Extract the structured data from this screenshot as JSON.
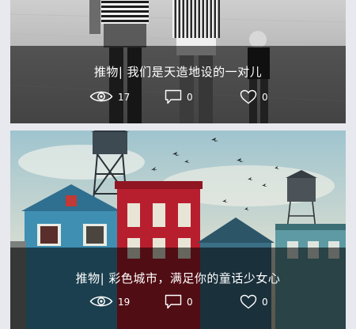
{
  "posts": [
    {
      "title": "推物| 我们是天造地设的一对儿",
      "views": "17",
      "comments": "0",
      "likes": "0",
      "image_icon": "family-beach-photo"
    },
    {
      "title": "推物| 彩色城市，满足你的童话少女心",
      "views": "19",
      "comments": "0",
      "likes": "0",
      "image_icon": "colorful-city-painting"
    }
  ],
  "icons": {
    "views": "eye-icon",
    "comments": "comment-icon",
    "likes": "heart-icon"
  },
  "colors": {
    "background": "#e7e9ee",
    "overlay": "rgba(0,0,0,0.56)",
    "text": "#ffffff"
  }
}
